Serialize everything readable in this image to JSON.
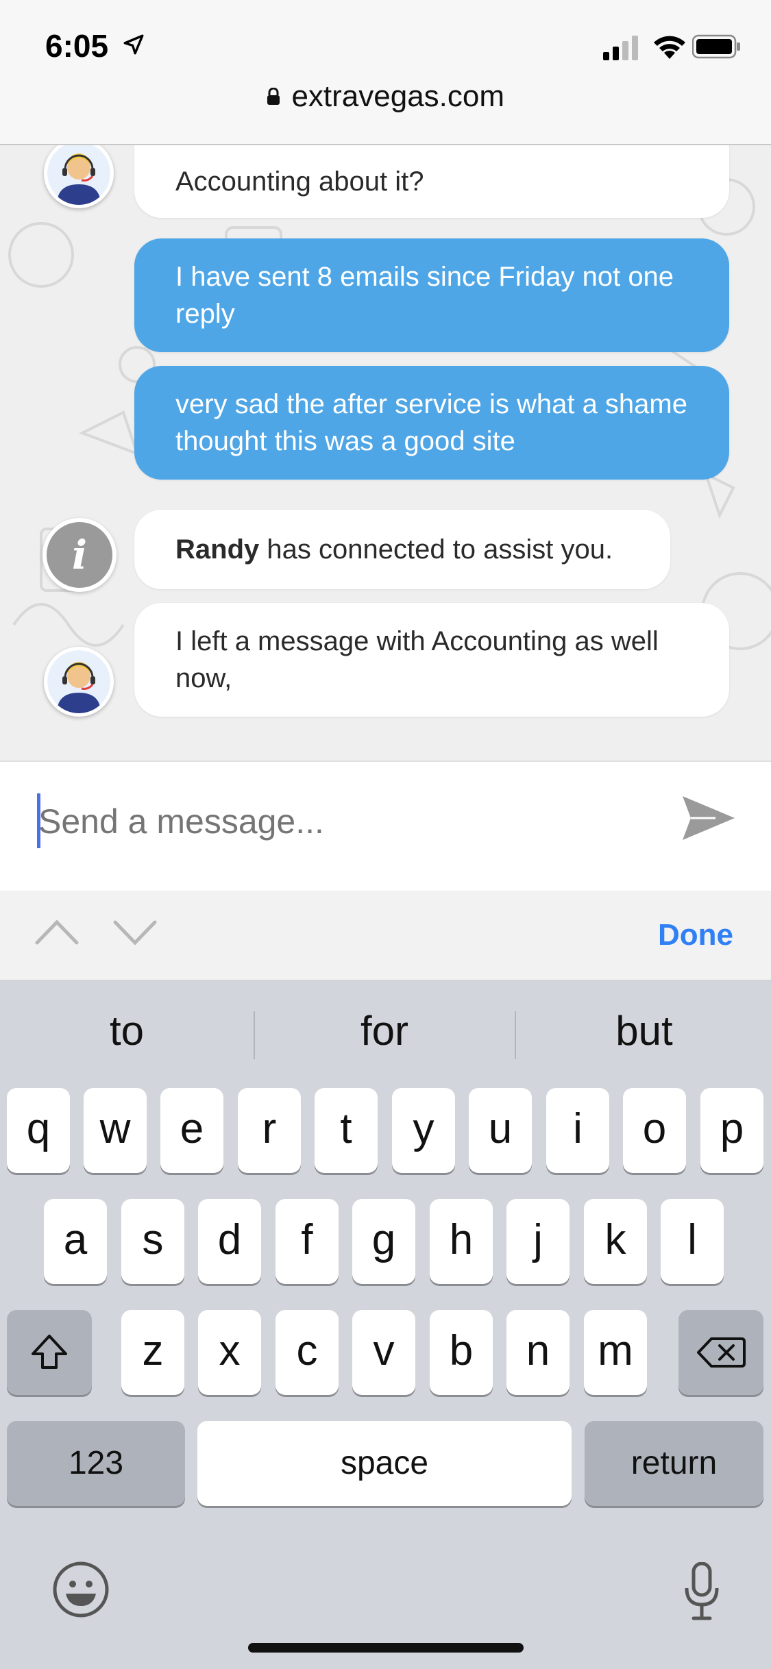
{
  "status_bar": {
    "time": "6:05"
  },
  "url_bar": {
    "url": "extravegas.com"
  },
  "messages": [
    {
      "sender": "agent",
      "text": "Accounting about it?"
    },
    {
      "sender": "user",
      "text": "I have sent 8 emails since Friday not one reply"
    },
    {
      "sender": "user",
      "text": "very sad the after service is what a shame thought this was a good site"
    },
    {
      "sender": "system",
      "name": "Randy",
      "text": " has connected to assist you."
    },
    {
      "sender": "agent",
      "text": "I left a message with Accounting as well now,"
    }
  ],
  "composer": {
    "placeholder": "Send a message..."
  },
  "accessory": {
    "done_label": "Done"
  },
  "keyboard": {
    "suggestions": [
      "to",
      "for",
      "but"
    ],
    "row1": [
      "q",
      "w",
      "e",
      "r",
      "t",
      "y",
      "u",
      "i",
      "o",
      "p"
    ],
    "row2": [
      "a",
      "s",
      "d",
      "f",
      "g",
      "h",
      "j",
      "k",
      "l"
    ],
    "row3": [
      "z",
      "x",
      "c",
      "v",
      "b",
      "n",
      "m"
    ],
    "numbers_label": "123",
    "space_label": "space",
    "return_label": "return"
  },
  "colors": {
    "user_bubble": "#4ea6e7",
    "accent": "#2f7ff5"
  },
  "icons": [
    "location-arrow-icon",
    "signal-icon",
    "wifi-icon",
    "battery-icon",
    "lock-icon",
    "agent-avatar-icon",
    "info-icon",
    "send-icon",
    "chevron-up-icon",
    "chevron-down-icon",
    "shift-icon",
    "backspace-icon",
    "emoji-icon",
    "microphone-icon"
  ]
}
